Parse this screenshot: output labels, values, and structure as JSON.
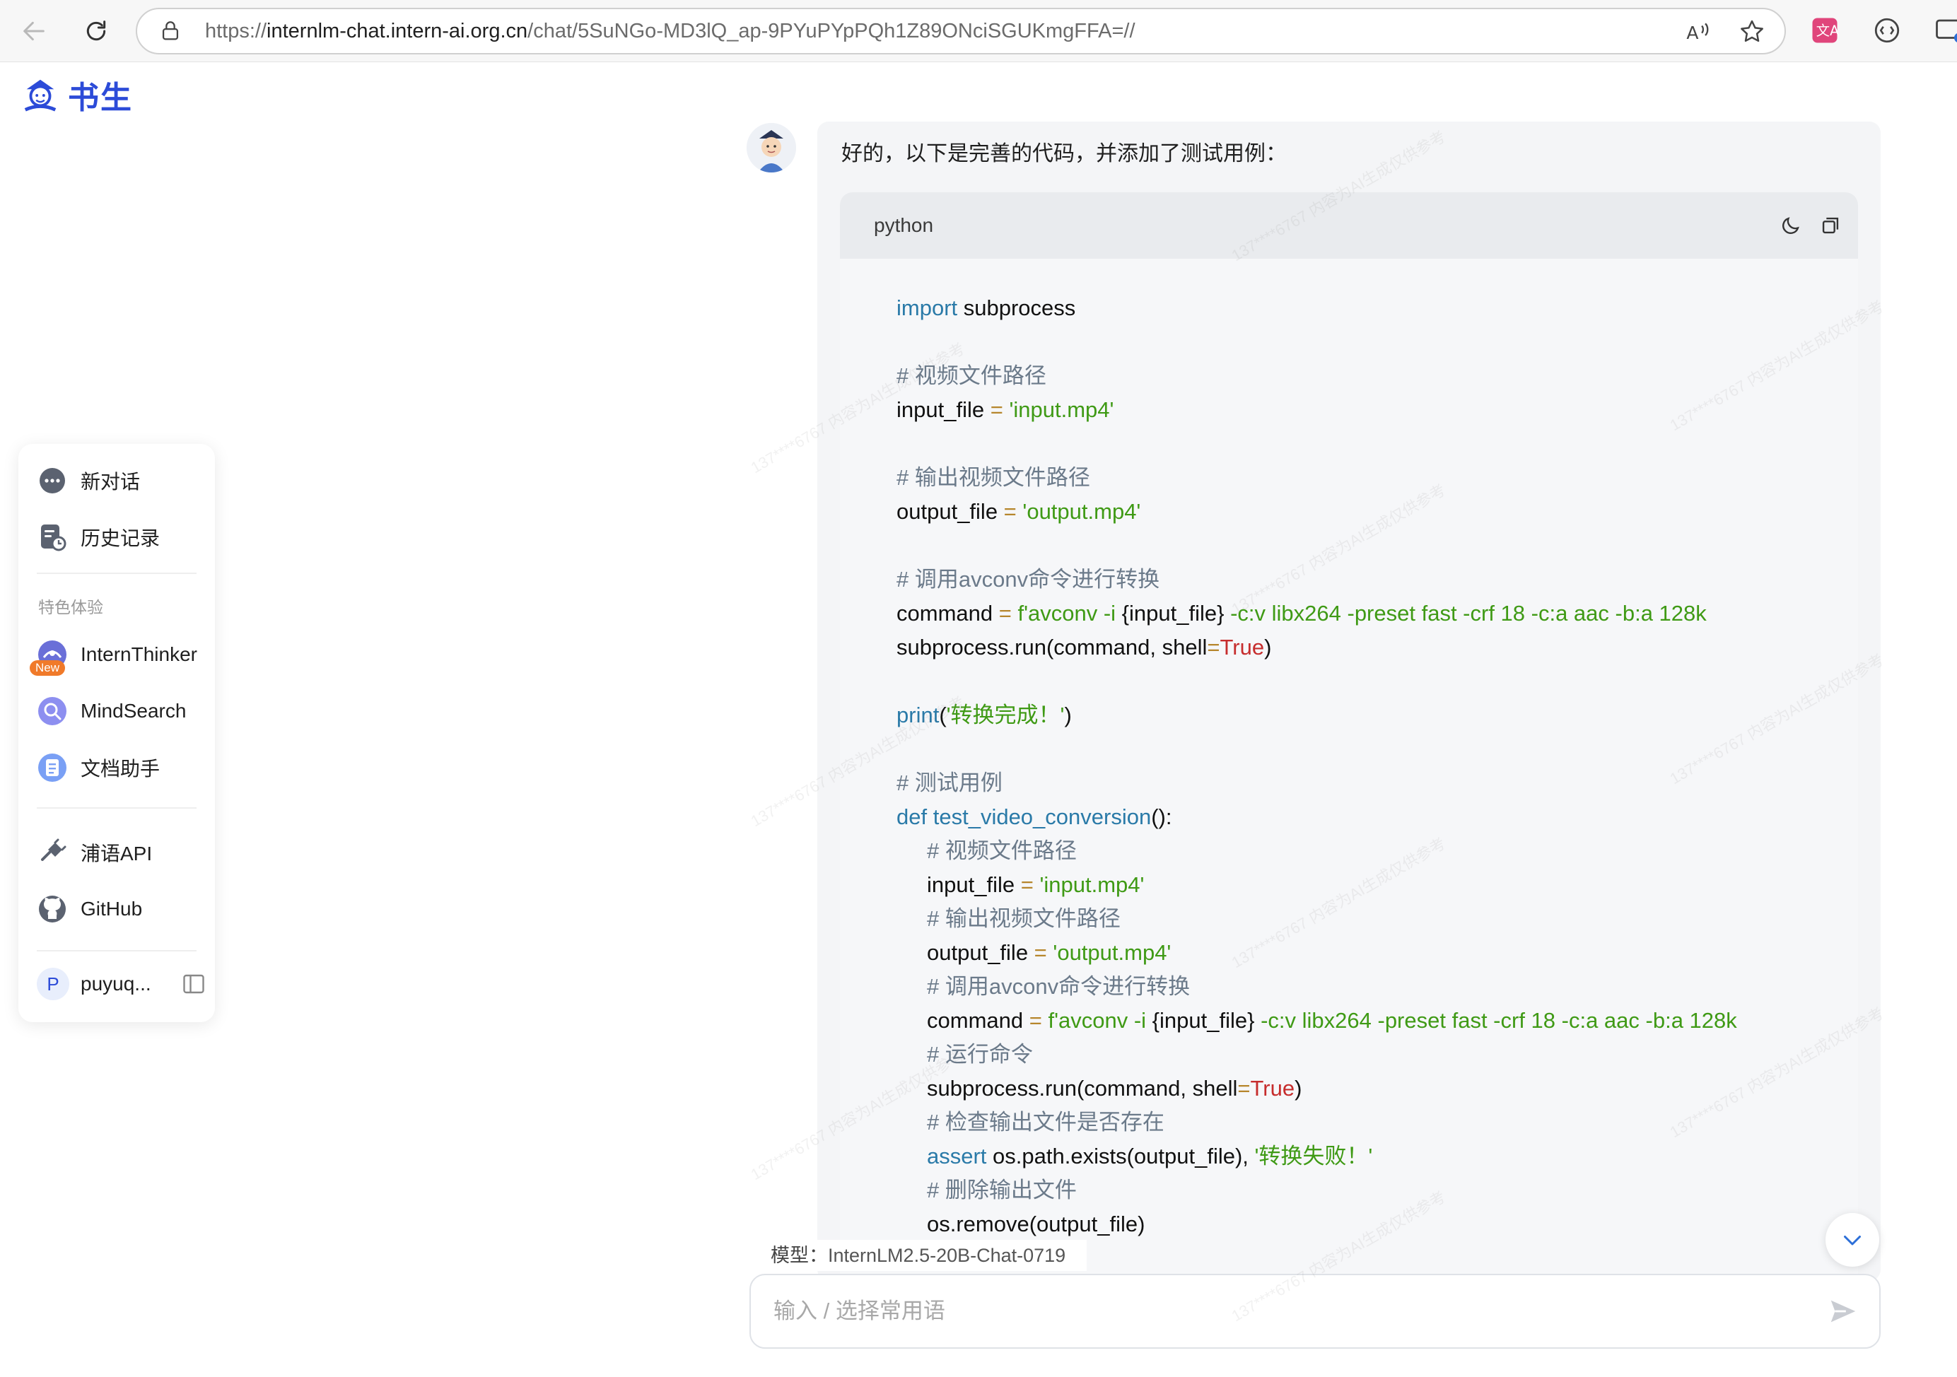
{
  "browser": {
    "url_prefix": "https://",
    "url_host": "internlm-chat.intern-ai.org.cn",
    "url_path": "/chat/5SuNGo-MD3lQ_ap-9PYuPYpPQh1Z89ONciSGUKmgFFA=//",
    "icons": [
      "back-icon",
      "reload-icon",
      "lock-icon",
      "read-aloud-icon",
      "favorite-star-icon",
      "translate-extension-icon",
      "extension-icon",
      "tabs-icon"
    ]
  },
  "logo": {
    "text": "书生"
  },
  "sidebar": {
    "new_chat": "新对话",
    "history": "历史记录",
    "section_label": "特色体验",
    "intern_thinker": "InternThinker",
    "new_badge": "New",
    "mind_search": "MindSearch",
    "doc_assistant": "文档助手",
    "puyu_api": "浦语API",
    "github": "GitHub",
    "user_initial": "P",
    "user_name": "puyuq..."
  },
  "chat": {
    "intro": "好的，以下是完善的代码，并添加了测试用例：",
    "code_language": "python",
    "model_label": "模型：",
    "model_value": "InternLM2.5-20B-Chat-0719",
    "input_placeholder": "输入 / 选择常用语",
    "watermark_text": "137****6767 内容为AI生成仅供参考"
  },
  "code_lines": [
    {
      "indent": false,
      "tokens": [
        [
          "kw",
          "import"
        ],
        [
          "pn",
          " subprocess"
        ]
      ]
    },
    {
      "indent": false,
      "tokens": []
    },
    {
      "indent": false,
      "tokens": [
        [
          "cm",
          "# 视频文件路径"
        ]
      ]
    },
    {
      "indent": false,
      "tokens": [
        [
          "pn",
          "input_file "
        ],
        [
          "op",
          "="
        ],
        [
          "pn",
          " "
        ],
        [
          "st",
          "'input.mp4'"
        ]
      ]
    },
    {
      "indent": false,
      "tokens": []
    },
    {
      "indent": false,
      "tokens": [
        [
          "cm",
          "# 输出视频文件路径"
        ]
      ]
    },
    {
      "indent": false,
      "tokens": [
        [
          "pn",
          "output_file "
        ],
        [
          "op",
          "="
        ],
        [
          "pn",
          " "
        ],
        [
          "st",
          "'output.mp4'"
        ]
      ]
    },
    {
      "indent": false,
      "tokens": []
    },
    {
      "indent": false,
      "tokens": [
        [
          "cm",
          "# 调用avconv命令进行转换"
        ]
      ]
    },
    {
      "indent": false,
      "tokens": [
        [
          "pn",
          "command "
        ],
        [
          "op",
          "="
        ],
        [
          "pn",
          " "
        ],
        [
          "st",
          "f'avconv -i "
        ],
        [
          "pn",
          "{input_file}"
        ],
        [
          "st",
          " -c:v libx264 -preset fast -crf 18 -c:a aac -b:a 128k"
        ]
      ]
    },
    {
      "indent": false,
      "tokens": [
        [
          "pn",
          "subprocess.run(command, shell"
        ],
        [
          "op",
          "="
        ],
        [
          "tr",
          "True"
        ],
        [
          "pn",
          ")"
        ]
      ]
    },
    {
      "indent": false,
      "tokens": []
    },
    {
      "indent": false,
      "tokens": [
        [
          "kw",
          "print"
        ],
        [
          "pn",
          "("
        ],
        [
          "st",
          "'转换完成！'"
        ],
        [
          "pn",
          ")"
        ]
      ]
    },
    {
      "indent": false,
      "tokens": []
    },
    {
      "indent": false,
      "tokens": [
        [
          "cm",
          "# 测试用例"
        ]
      ]
    },
    {
      "indent": false,
      "tokens": [
        [
          "kw",
          "def"
        ],
        [
          "pn",
          " "
        ],
        [
          "kw",
          "test_video_conversion"
        ],
        [
          "pn",
          "():"
        ]
      ]
    },
    {
      "indent": true,
      "tokens": [
        [
          "cm",
          "# 视频文件路径"
        ]
      ]
    },
    {
      "indent": true,
      "tokens": [
        [
          "pn",
          "input_file "
        ],
        [
          "op",
          "="
        ],
        [
          "pn",
          " "
        ],
        [
          "st",
          "'input.mp4'"
        ]
      ]
    },
    {
      "indent": true,
      "tokens": [
        [
          "cm",
          "# 输出视频文件路径"
        ]
      ]
    },
    {
      "indent": true,
      "tokens": [
        [
          "pn",
          "output_file "
        ],
        [
          "op",
          "="
        ],
        [
          "pn",
          " "
        ],
        [
          "st",
          "'output.mp4'"
        ]
      ]
    },
    {
      "indent": true,
      "tokens": [
        [
          "cm",
          "# 调用avconv命令进行转换"
        ]
      ]
    },
    {
      "indent": true,
      "tokens": [
        [
          "pn",
          "command "
        ],
        [
          "op",
          "="
        ],
        [
          "pn",
          " "
        ],
        [
          "st",
          "f'avconv -i "
        ],
        [
          "pn",
          "{input_file}"
        ],
        [
          "st",
          " -c:v libx264 -preset fast -crf 18 -c:a aac -b:a 128k"
        ]
      ]
    },
    {
      "indent": true,
      "tokens": [
        [
          "cm",
          "# 运行命令"
        ]
      ]
    },
    {
      "indent": true,
      "tokens": [
        [
          "pn",
          "subprocess.run(command, shell"
        ],
        [
          "op",
          "="
        ],
        [
          "tr",
          "True"
        ],
        [
          "pn",
          ")"
        ]
      ]
    },
    {
      "indent": true,
      "tokens": [
        [
          "cm",
          "# 检查输出文件是否存在"
        ]
      ]
    },
    {
      "indent": true,
      "tokens": [
        [
          "kw",
          "assert"
        ],
        [
          "pn",
          " os.path.exists(output_file), "
        ],
        [
          "st",
          "'转换失败！'"
        ]
      ]
    },
    {
      "indent": true,
      "tokens": [
        [
          "cm",
          "# 删除输出文件"
        ]
      ]
    },
    {
      "indent": true,
      "tokens": [
        [
          "pn",
          "os.remove(output_file)"
        ]
      ]
    }
  ]
}
